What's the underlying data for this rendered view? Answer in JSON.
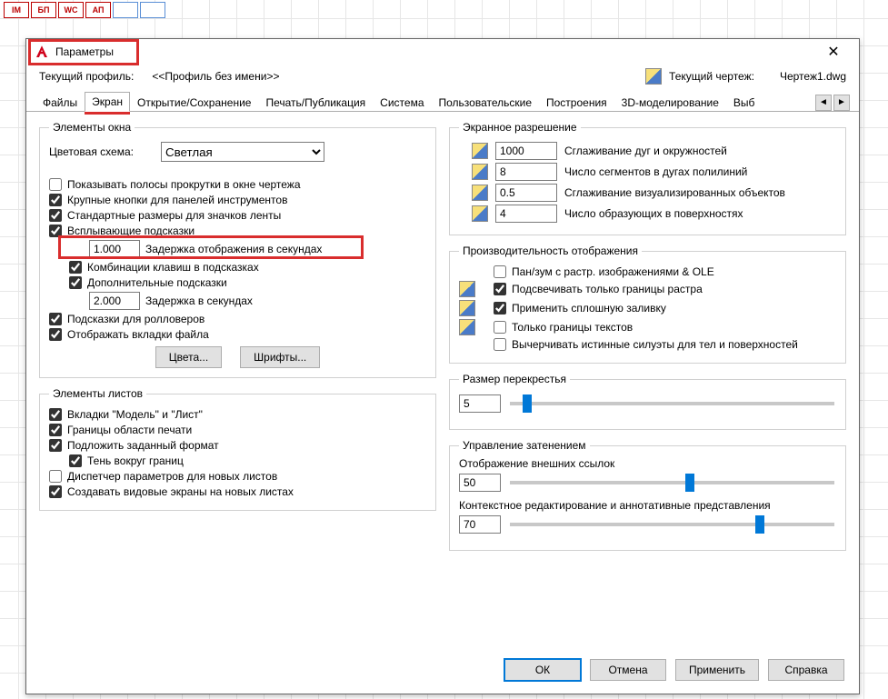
{
  "window": {
    "title": "Параметры"
  },
  "profile": {
    "label": "Текущий профиль:",
    "value": "<<Профиль без имени>>",
    "drawing_label": "Текущий чертеж:",
    "drawing_value": "Чертеж1.dwg"
  },
  "tabs": [
    "Файлы",
    "Экран",
    "Открытие/Сохранение",
    "Печать/Публикация",
    "Система",
    "Пользовательские",
    "Построения",
    "3D-моделирование",
    "Выб"
  ],
  "left": {
    "group_window": {
      "legend": "Элементы окна",
      "color_scheme_label": "Цветовая схема:",
      "color_scheme_value": "Светлая",
      "scrollbars": "Показывать полосы прокрутки в окне чертежа",
      "large_buttons": "Крупные кнопки для панелей инструментов",
      "std_ribbon": "Стандартные размеры для значков ленты",
      "tooltips": "Всплывающие подсказки",
      "tooltip_delay_value": "1.000",
      "tooltip_delay_label": "Задержка отображения в секундах",
      "hotkeys": "Комбинации клавиш в подсказках",
      "ext_tooltips": "Дополнительные подсказки",
      "ext_delay_value": "2.000",
      "ext_delay_label": "Задержка в секундах",
      "rollover": "Подсказки для ролловеров",
      "file_tabs": "Отображать вкладки файла",
      "btn_colors": "Цвета...",
      "btn_fonts": "Шрифты..."
    },
    "group_sheets": {
      "legend": "Элементы листов",
      "tabs_ml": "Вкладки \"Модель\" и \"Лист\"",
      "print_bounds": "Границы области печати",
      "paper_bg": "Подложить заданный формат",
      "shadow": "Тень вокруг границ",
      "page_setup_mgr": "Диспетчер параметров для новых листов",
      "viewports": "Создавать видовые экраны на новых листах"
    }
  },
  "right": {
    "group_res": {
      "legend": "Экранное разрешение",
      "r1_value": "1000",
      "r1_label": "Сглаживание дуг и окружностей",
      "r2_value": "8",
      "r2_label": "Число сегментов в дугах полилиний",
      "r3_value": "0.5",
      "r3_label": "Сглаживание визуализированных объектов",
      "r4_value": "4",
      "r4_label": "Число образующих в поверхностях"
    },
    "group_perf": {
      "legend": "Производительность отображения",
      "panzoom": "Пан/зум с растр. изображениями & OLE",
      "raster_frames": "Подсвечивать только границы растра",
      "solid_fill": "Применить сплошную заливку",
      "text_frames": "Только границы текстов",
      "true_silhouettes": "Вычерчивать истинные силуэты для тел и поверхностей"
    },
    "group_cross": {
      "legend": "Размер перекрестья",
      "value": "5"
    },
    "group_fade": {
      "legend": "Управление затенением",
      "xref_label": "Отображение внешних ссылок",
      "xref_value": "50",
      "inplace_label": "Контекстное редактирование и аннотативные представления",
      "inplace_value": "70"
    }
  },
  "buttons": {
    "ok": "ОК",
    "cancel": "Отмена",
    "apply": "Применить",
    "help": "Справка"
  }
}
